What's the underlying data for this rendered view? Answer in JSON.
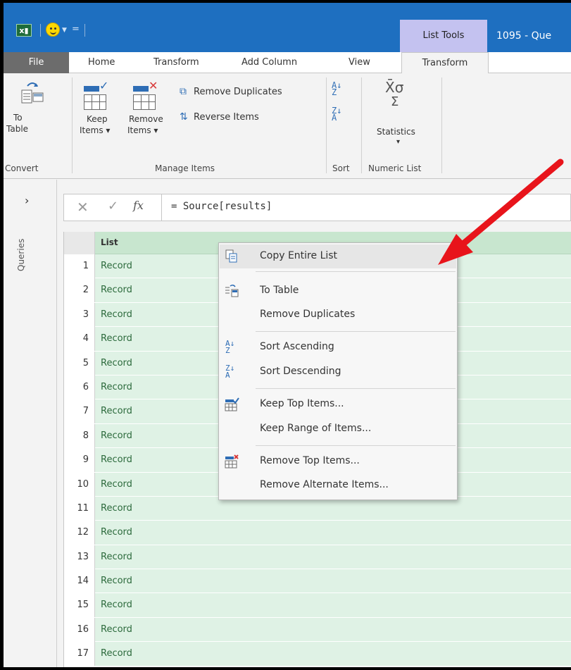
{
  "titlebar": {
    "context_tab": "List Tools",
    "document_title": "1095 - Que"
  },
  "tabs": [
    {
      "label": "File"
    },
    {
      "label": "Home"
    },
    {
      "label": "Transform"
    },
    {
      "label": "Add Column"
    },
    {
      "label": "View"
    },
    {
      "label": "Transform"
    }
  ],
  "ribbon": {
    "to_table_line1": "To",
    "to_table_line2": "Table",
    "keep_items_line1": "Keep",
    "keep_items_line2": "Items ▾",
    "remove_items_line1": "Remove",
    "remove_items_line2": "Items ▾",
    "remove_duplicates": "Remove Duplicates",
    "reverse_items": "Reverse Items",
    "statistics": "Statistics",
    "statistics_arrow": "▾",
    "groups": {
      "convert": "Convert",
      "manage_items": "Manage Items",
      "sort": "Sort",
      "numeric_list": "Numeric List"
    }
  },
  "side": {
    "queries_label": "Queries",
    "expand_glyph": "›"
  },
  "formula_bar": {
    "cancel_glyph": "✕",
    "confirm_glyph": "✓",
    "fx_label": "fx",
    "formula": "= Source[results]"
  },
  "grid": {
    "column_header": "List",
    "rows": [
      {
        "n": "1",
        "value": "Record"
      },
      {
        "n": "2",
        "value": "Record"
      },
      {
        "n": "3",
        "value": "Record"
      },
      {
        "n": "4",
        "value": "Record"
      },
      {
        "n": "5",
        "value": "Record"
      },
      {
        "n": "6",
        "value": "Record"
      },
      {
        "n": "7",
        "value": "Record"
      },
      {
        "n": "8",
        "value": "Record"
      },
      {
        "n": "9",
        "value": "Record"
      },
      {
        "n": "10",
        "value": "Record"
      },
      {
        "n": "11",
        "value": "Record"
      },
      {
        "n": "12",
        "value": "Record"
      },
      {
        "n": "13",
        "value": "Record"
      },
      {
        "n": "14",
        "value": "Record"
      },
      {
        "n": "15",
        "value": "Record"
      },
      {
        "n": "16",
        "value": "Record"
      },
      {
        "n": "17",
        "value": "Record"
      }
    ]
  },
  "context_menu": {
    "items": [
      {
        "label": "Copy Entire List",
        "icon": "copy-icon"
      },
      {
        "label": "To Table",
        "icon": "to-table-icon"
      },
      {
        "label": "Remove Duplicates",
        "icon": ""
      },
      {
        "label": "Sort Ascending",
        "icon": "sort-ascending-icon"
      },
      {
        "label": "Sort Descending",
        "icon": "sort-descending-icon"
      },
      {
        "label": "Keep Top Items...",
        "icon": "keep-top-icon"
      },
      {
        "label": "Keep Range of Items...",
        "icon": ""
      },
      {
        "label": "Remove Top Items...",
        "icon": "remove-top-icon"
      },
      {
        "label": "Remove Alternate Items...",
        "icon": ""
      }
    ]
  },
  "colors": {
    "title_blue": "#1e6fc0",
    "context_purple": "#c4c2f0",
    "grid_green": "#dff2e5",
    "header_green": "#c8e6cf",
    "arrow_red": "#e8141b"
  }
}
